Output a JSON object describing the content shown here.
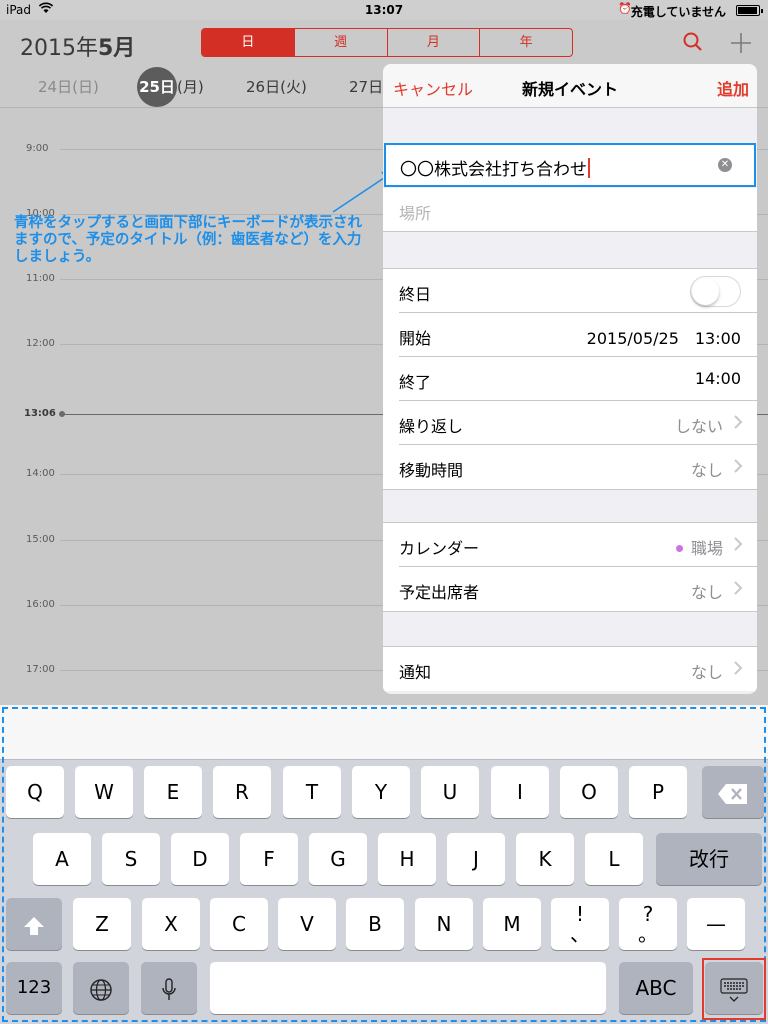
{
  "status": {
    "device": "iPad",
    "time": "13:07",
    "charge": "充電していません"
  },
  "header": {
    "year": "2015年",
    "month": "5月",
    "segments": [
      "日",
      "週",
      "月",
      "年"
    ],
    "days": [
      {
        "label": "24日(日)",
        "state": "dim"
      },
      {
        "num": "25日",
        "wd": "(月)",
        "state": "selected"
      },
      {
        "label": "26日(火)",
        "state": "normal"
      },
      {
        "label": "27日",
        "state": "normal"
      }
    ]
  },
  "timeline": {
    "hours": [
      "9:00",
      "10:00",
      "11:00",
      "12:00",
      "13:06",
      "14:00",
      "15:00",
      "16:00",
      "17:00"
    ],
    "now": "13:06"
  },
  "annotation": "青枠をタップすると画面下部にキーボードが表示されますので、予定のタイトル（例：歯医者など）を入力しましょう。",
  "popover": {
    "cancel": "キャンセル",
    "title": "新規イベント",
    "add": "追加",
    "event_title": "〇〇株式会社打ち合わせ",
    "location_placeholder": "場所",
    "allday": "終日",
    "start_label": "開始",
    "start_value": "2015/05/25　13:00",
    "end_label": "終了",
    "end_value": "14:00",
    "repeat_label": "繰り返し",
    "repeat_value": "しない",
    "travel_label": "移動時間",
    "travel_value": "なし",
    "calendar_label": "カレンダー",
    "calendar_value": "職場",
    "calendar_color": "#cc73e1",
    "invitees_label": "予定出席者",
    "invitees_value": "なし",
    "alert_label": "通知",
    "alert_value": "なし"
  },
  "keyboard": {
    "row1": [
      "Q",
      "W",
      "E",
      "R",
      "T",
      "Y",
      "U",
      "I",
      "O",
      "P"
    ],
    "row2": [
      "A",
      "S",
      "D",
      "F",
      "G",
      "H",
      "J",
      "K",
      "L"
    ],
    "return": "改行",
    "row3": [
      "Z",
      "X",
      "C",
      "V",
      "B",
      "N",
      "M",
      "!\n、",
      "?\n。",
      "—"
    ],
    "numbers": "123",
    "abc": "ABC"
  },
  "colors": {
    "accent_red": "#e23b2e",
    "annotation_blue": "#1e8fe8"
  }
}
